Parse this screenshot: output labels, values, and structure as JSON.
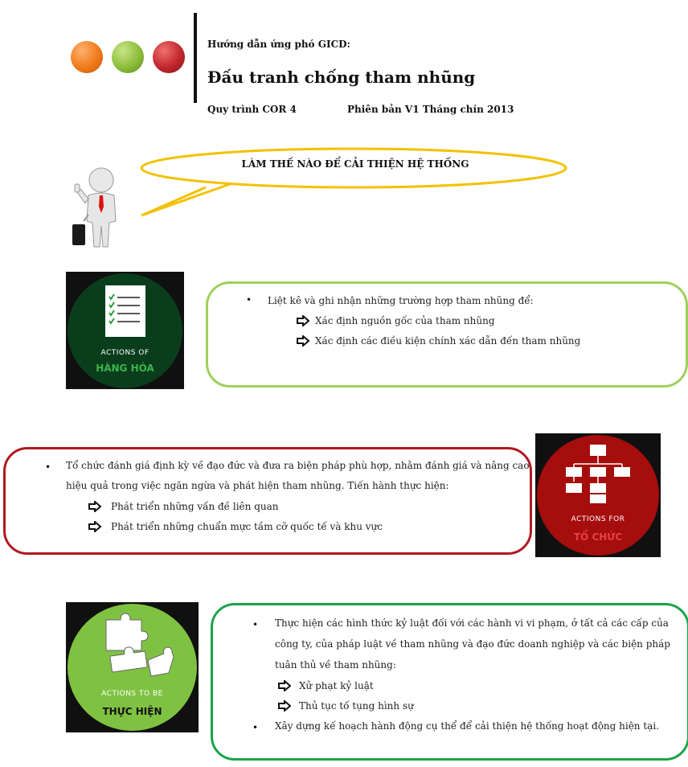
{
  "header": {
    "guide_label": "Hướng dẫn ứng phó GICD:",
    "title": "Đấu tranh chống tham nhũng",
    "process": "Quy trình COR 4",
    "version": "Phiên bản V1 Tháng chín 2013",
    "dot_colors": [
      "#f07a1a",
      "#8cbd3a",
      "#c0272d"
    ]
  },
  "callout": {
    "text": "LÀM THẾ NÀO ĐỂ CẢI THIỆN HỆ THỐNG",
    "border_color": "#f2c200"
  },
  "sections": [
    {
      "tile": {
        "caption": "ACTIONS OF",
        "name": "HÀNG HÓA",
        "bg": "#0a3d1c",
        "name_color": "#3bb54a",
        "icon": "checklist-icon"
      },
      "box_color": "#9fd05a",
      "bullet": "Liệt kê và ghi nhận những trường hợp tham nhũng để:",
      "items": [
        "Xác định nguồn gốc của tham nhũng",
        "Xác định các điều kiện chính xác dẫn đến tham nhũng"
      ]
    },
    {
      "tile": {
        "caption": "ACTIONS FOR",
        "name": "TỔ CHỨC",
        "bg": "#a60d0d",
        "name_color": "#e84040",
        "icon": "org-chart-icon"
      },
      "box_color": "#b0191f",
      "bullet_lines": [
        "Tổ chức đánh giá định kỳ về đạo đức và đưa ra biện pháp phù hợp, nhằm đánh giá và nâng cao",
        "hiệu quả trong việc ngăn ngừa và phát hiện tham nhũng. Tiến hành thực hiện:"
      ],
      "items": [
        "Phát triển những vấn đề liên quan",
        "Phát triển những chuẩn mực tầm cỡ quốc tế và khu vực"
      ]
    },
    {
      "tile": {
        "caption": "ACTIONS TO BE",
        "name": "THỰC HIỆN",
        "bg": "#7fc242",
        "name_color": "#111111",
        "icon": "puzzle-icon"
      },
      "box_color": "#1aa34a",
      "bullet_lines": [
        "Thực hiện các hình thức kỷ luật đối với các hành vi vi phạm, ở tất cả các cấp của",
        "công ty, của pháp luật về tham nhũng và đạo đức doanh nghiệp và các biện pháp",
        "tuân thủ về tham nhũng:"
      ],
      "items": [
        "Xử phạt kỷ luật",
        "Thủ tục tố tụng hình sự"
      ],
      "bullet2": "Xây dựng kế hoạch hành động cụ thể để cải thiện hệ thống hoạt động hiện tại."
    }
  ]
}
